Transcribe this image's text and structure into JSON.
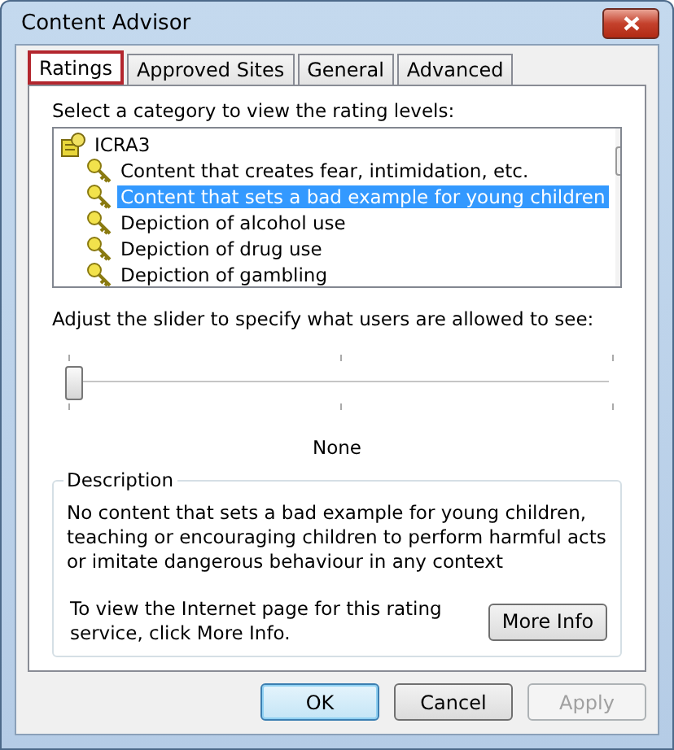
{
  "window": {
    "title": "Content Advisor"
  },
  "tabs": [
    {
      "label": "Ratings",
      "selected": true
    },
    {
      "label": "Approved Sites",
      "selected": false
    },
    {
      "label": "General",
      "selected": false
    },
    {
      "label": "Advanced",
      "selected": false
    }
  ],
  "category_prompt": "Select a category to view the rating levels:",
  "tree": [
    {
      "label": "ICRA3",
      "kind": "service",
      "selected": false,
      "children": [
        {
          "label": "Content that creates fear, intimidation, etc.",
          "kind": "category",
          "selected": false
        },
        {
          "label": "Content that sets a bad example for young children",
          "kind": "category",
          "selected": true
        },
        {
          "label": "Depiction of alcohol use",
          "kind": "category",
          "selected": false
        },
        {
          "label": "Depiction of drug use",
          "kind": "category",
          "selected": false
        },
        {
          "label": "Depiction of gambling",
          "kind": "category",
          "selected": false
        }
      ]
    }
  ],
  "slider_prompt": "Adjust the slider to specify what users are allowed to see:",
  "slider": {
    "level": 0,
    "reading": "None"
  },
  "description": {
    "title": "Description",
    "text": "No content that sets a bad example for young children, teaching or encouraging children to perform harmful acts or imitate dangerous behaviour in any context",
    "info": "To view the Internet page for this rating service, click More Info.",
    "button": "More Info"
  },
  "buttons": [
    {
      "label": "OK",
      "default": true,
      "disabled": false
    },
    {
      "label": "Cancel",
      "default": false,
      "disabled": false
    },
    {
      "label": "Apply",
      "default": false,
      "disabled": true
    }
  ]
}
